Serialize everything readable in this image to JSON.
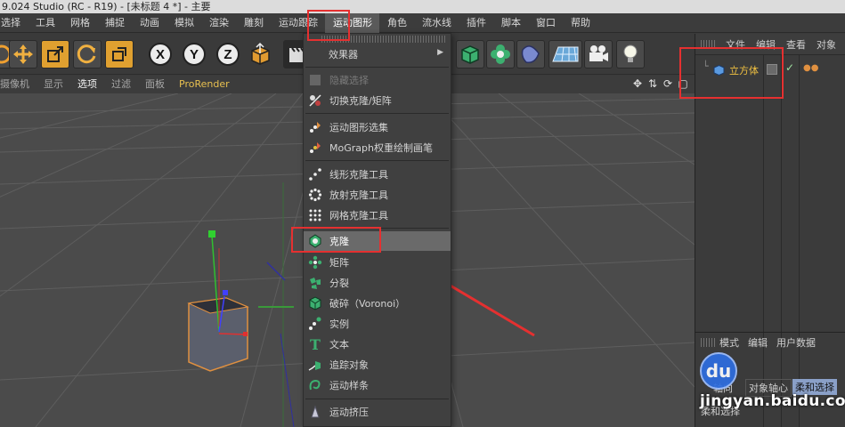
{
  "window": {
    "title": "9.024 Studio (RC - R19) - [未标题 4 *] - 主要"
  },
  "menubar": {
    "items": [
      {
        "label": "选择",
        "active": false
      },
      {
        "label": "工具",
        "active": false
      },
      {
        "label": "网格",
        "active": false
      },
      {
        "label": "捕捉",
        "active": false
      },
      {
        "label": "动画",
        "active": false
      },
      {
        "label": "模拟",
        "active": false
      },
      {
        "label": "渲染",
        "active": false
      },
      {
        "label": "雕刻",
        "active": false
      },
      {
        "label": "运动跟踪",
        "active": false
      },
      {
        "label": "运动图形",
        "active": true
      },
      {
        "label": "角色",
        "active": false
      },
      {
        "label": "流水线",
        "active": false
      },
      {
        "label": "插件",
        "active": false
      },
      {
        "label": "脚本",
        "active": false
      },
      {
        "label": "窗口",
        "active": false
      },
      {
        "label": "帮助",
        "active": false
      }
    ]
  },
  "toolbar": {
    "axis_x": "X",
    "axis_y": "Y",
    "axis_z": "Z"
  },
  "viewbar": {
    "items": [
      "摄像机",
      "显示",
      "选项",
      "过滤",
      "面板",
      "ProRender"
    ]
  },
  "dropdown": {
    "effector": "效果器",
    "hide_selection": "隐藏选择",
    "toggle_clone": "切换克隆/矩阵",
    "mograph_selection": "运动图形选集",
    "mograph_weight_paint": "MoGraph权重绘制画笔",
    "linear_clone_tool": "线形克隆工具",
    "radial_clone_tool": "放射克隆工具",
    "grid_clone_tool": "网格克隆工具",
    "cloner": "克隆",
    "matrix": "矩阵",
    "fracture": "分裂",
    "voronoi_fracture": "破碎（Voronoi）",
    "instance": "实例",
    "text": "文本",
    "tracer": "追踪对象",
    "mospline": "运动样条",
    "extrude": "运动挤压"
  },
  "objects_panel": {
    "tabs": [
      "文件",
      "编辑",
      "查看",
      "对象"
    ],
    "object_name": "立方体"
  },
  "attributes_panel": {
    "tabs": [
      "模式",
      "编辑",
      "用户数据"
    ],
    "row1_left": "轴向",
    "row1_mid": "对象轴心",
    "row1_right": "柔和选择",
    "row2": "柔和选择"
  },
  "watermark": {
    "logo": "du",
    "site": "jingyan.baidu.com"
  },
  "colors": {
    "accent_orange": "#e0a030",
    "annotation_red": "#e53030",
    "highlight_gray": "#6a6a6a"
  }
}
